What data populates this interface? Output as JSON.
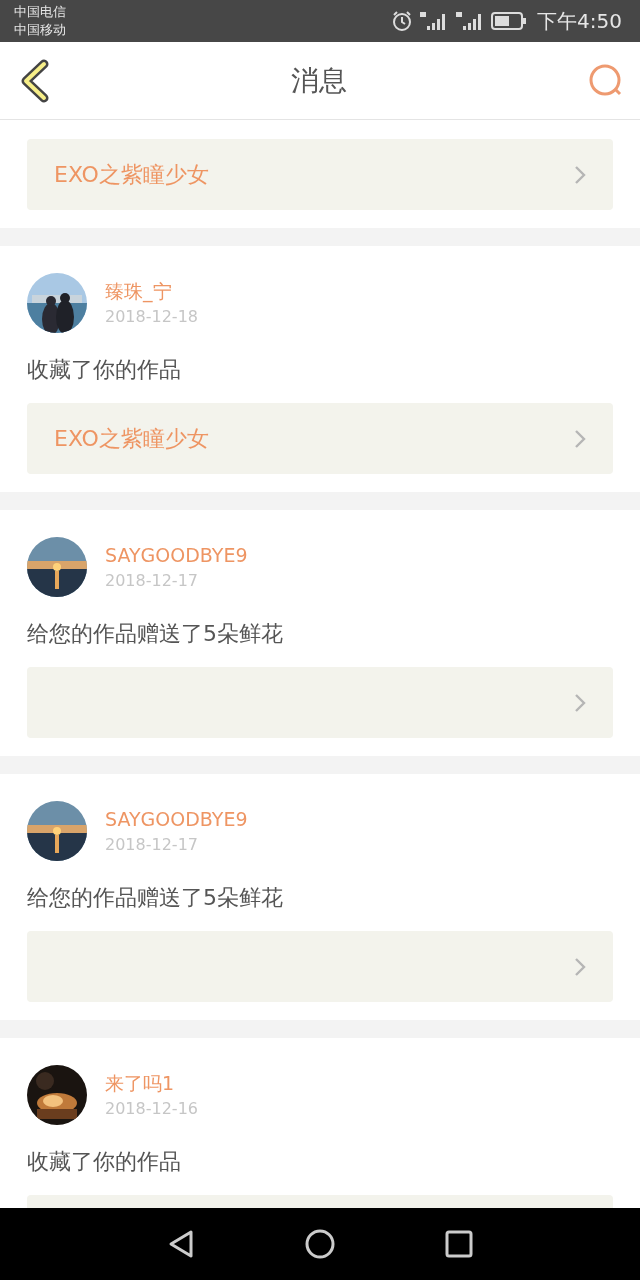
{
  "status_bar": {
    "carriers": [
      "中国电信",
      "中国移动"
    ],
    "time": "下午4:50"
  },
  "header": {
    "title": "消息"
  },
  "messages": [
    {
      "link": {
        "title": "EXO之紫瞳少女",
        "chevron": true
      }
    },
    {
      "user": "臻珠_宁",
      "date": "2018-12-18",
      "text": "收藏了你的作品",
      "link": {
        "title": "EXO之紫瞳少女",
        "chevron": true
      }
    },
    {
      "user": "SAYGOODBYE9",
      "date": "2018-12-17",
      "text": "给您的作品赠送了5朵鲜花",
      "link": {
        "chevron": true
      }
    },
    {
      "user": "SAYGOODBYE9",
      "date": "2018-12-17",
      "text": "给您的作品赠送了5朵鲜花",
      "link": {
        "chevron": true
      }
    },
    {
      "user": "来了吗1",
      "date": "2018-12-16",
      "text": "收藏了你的作品",
      "link": {
        "chevron": false
      }
    }
  ]
}
